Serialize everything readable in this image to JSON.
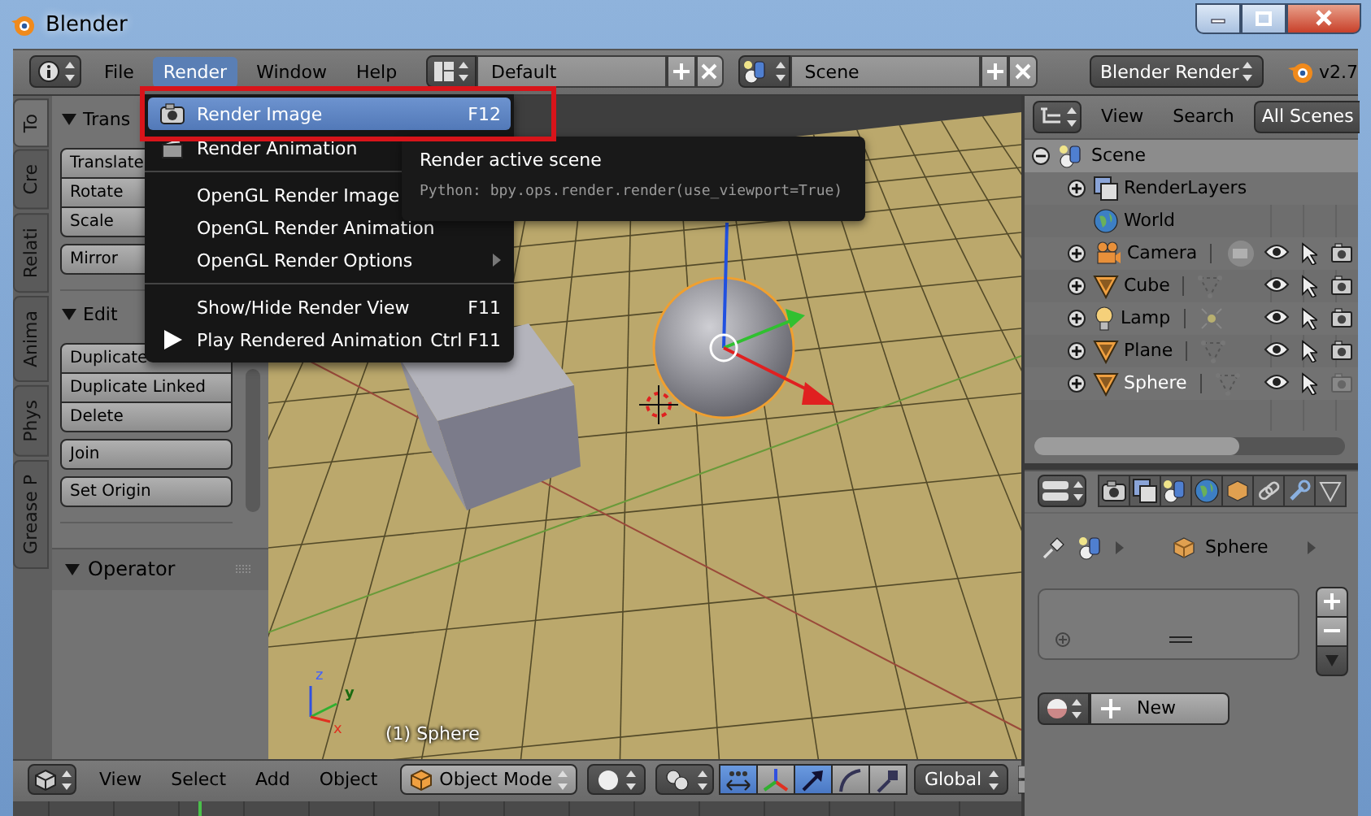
{
  "window": {
    "title": "Blender"
  },
  "info_header": {
    "menus": [
      {
        "label": "File",
        "selected": false
      },
      {
        "label": "Render",
        "selected": true
      },
      {
        "label": "Window",
        "selected": false
      },
      {
        "label": "Help",
        "selected": false
      }
    ],
    "layout": "Default",
    "scene": "Scene",
    "engine": "Blender Render",
    "version": "v2.7"
  },
  "render_menu": {
    "items": [
      {
        "kind": "render",
        "label": "Render Image",
        "shortcut": "F12",
        "selected": true
      },
      {
        "kind": "animation",
        "label": "Render Animation",
        "selected": false
      },
      {
        "kind": "separator"
      },
      {
        "kind": "plain",
        "label": "OpenGL Render Image",
        "selected": false
      },
      {
        "kind": "plain",
        "label": "OpenGL Render Animation",
        "selected": false
      },
      {
        "kind": "submenu",
        "label": "OpenGL Render Options",
        "selected": false
      },
      {
        "kind": "separator"
      },
      {
        "kind": "plain",
        "label": "Show/Hide Render View",
        "shortcut": "F11",
        "selected": false
      },
      {
        "kind": "play",
        "label": "Play Rendered Animation",
        "shortcut": "Ctrl F11",
        "selected": false
      }
    ]
  },
  "tooltip": {
    "title": "Render active scene",
    "python": "Python: bpy.ops.render.render(use_viewport=True)"
  },
  "tool_tabs": [
    {
      "label": "To",
      "selected": true
    },
    {
      "label": "Cre",
      "selected": false
    },
    {
      "label": "Relati",
      "selected": false
    },
    {
      "label": "Anima",
      "selected": false
    },
    {
      "label": "Phys",
      "selected": false
    },
    {
      "label": "Grease P",
      "selected": false
    }
  ],
  "tool_shelf": {
    "panels": [
      {
        "title": "Trans",
        "expanded": true,
        "groups": [
          [
            "Translate",
            "Rotate",
            "Scale"
          ],
          [
            "Mirror"
          ]
        ]
      },
      {
        "title": "Edit",
        "expanded": true,
        "groups": [
          [
            "Duplicate",
            "Duplicate Linked",
            "Delete"
          ],
          [
            "Join"
          ],
          [
            "Set Origin"
          ]
        ]
      }
    ]
  },
  "operator_panel": {
    "title": "Operator",
    "expanded": true
  },
  "viewport": {
    "object_label": "(1) Sphere",
    "axis_labels": [
      "z",
      "y",
      "x"
    ]
  },
  "outliner": {
    "menus": [
      "View",
      "Search"
    ],
    "filter": "All Scenes",
    "tree": [
      {
        "label": "Scene",
        "kind": "scene",
        "expanded": true,
        "active": true,
        "selected": false,
        "children": [
          {
            "label": "RenderLayers",
            "kind": "layers",
            "expanded": false,
            "active": false,
            "selected": false
          },
          {
            "label": "World",
            "kind": "world",
            "active": false,
            "selected": false
          },
          {
            "label": "Camera",
            "kind": "camera",
            "expanded": false,
            "active": false,
            "selected": false,
            "visible": true,
            "selectable": true,
            "renderable": true
          },
          {
            "label": "Cube",
            "kind": "mesh",
            "expanded": false,
            "active": false,
            "selected": false,
            "visible": true,
            "selectable": true,
            "renderable": true
          },
          {
            "label": "Lamp",
            "kind": "lamp",
            "expanded": false,
            "active": false,
            "selected": false,
            "visible": true,
            "selectable": true,
            "renderable": true
          },
          {
            "label": "Plane",
            "kind": "mesh",
            "expanded": false,
            "active": false,
            "selected": false,
            "visible": true,
            "selectable": true,
            "renderable": true
          },
          {
            "label": "Sphere",
            "kind": "mesh",
            "expanded": false,
            "active": false,
            "selected": true,
            "visible": true,
            "selectable": true,
            "renderable": false
          }
        ]
      }
    ]
  },
  "properties": {
    "tabs": [
      {
        "kind": "render"
      },
      {
        "kind": "layers"
      },
      {
        "kind": "scene"
      },
      {
        "kind": "world"
      },
      {
        "kind": "object"
      },
      {
        "kind": "constraints"
      },
      {
        "kind": "modifiers"
      },
      {
        "kind": "data"
      }
    ],
    "path": "Sphere",
    "new_button": "New"
  },
  "view3d_header": {
    "menus": [
      "View",
      "Select",
      "Add",
      "Object"
    ],
    "mode": "Object Mode",
    "tools": [
      {
        "kind": "manipulator",
        "selected": true
      },
      {
        "kind": "axes",
        "selected": false
      },
      {
        "kind": "translate",
        "selected": true
      },
      {
        "kind": "rotate",
        "selected": false
      },
      {
        "kind": "scale",
        "selected": false
      }
    ],
    "orientation": "Global"
  }
}
